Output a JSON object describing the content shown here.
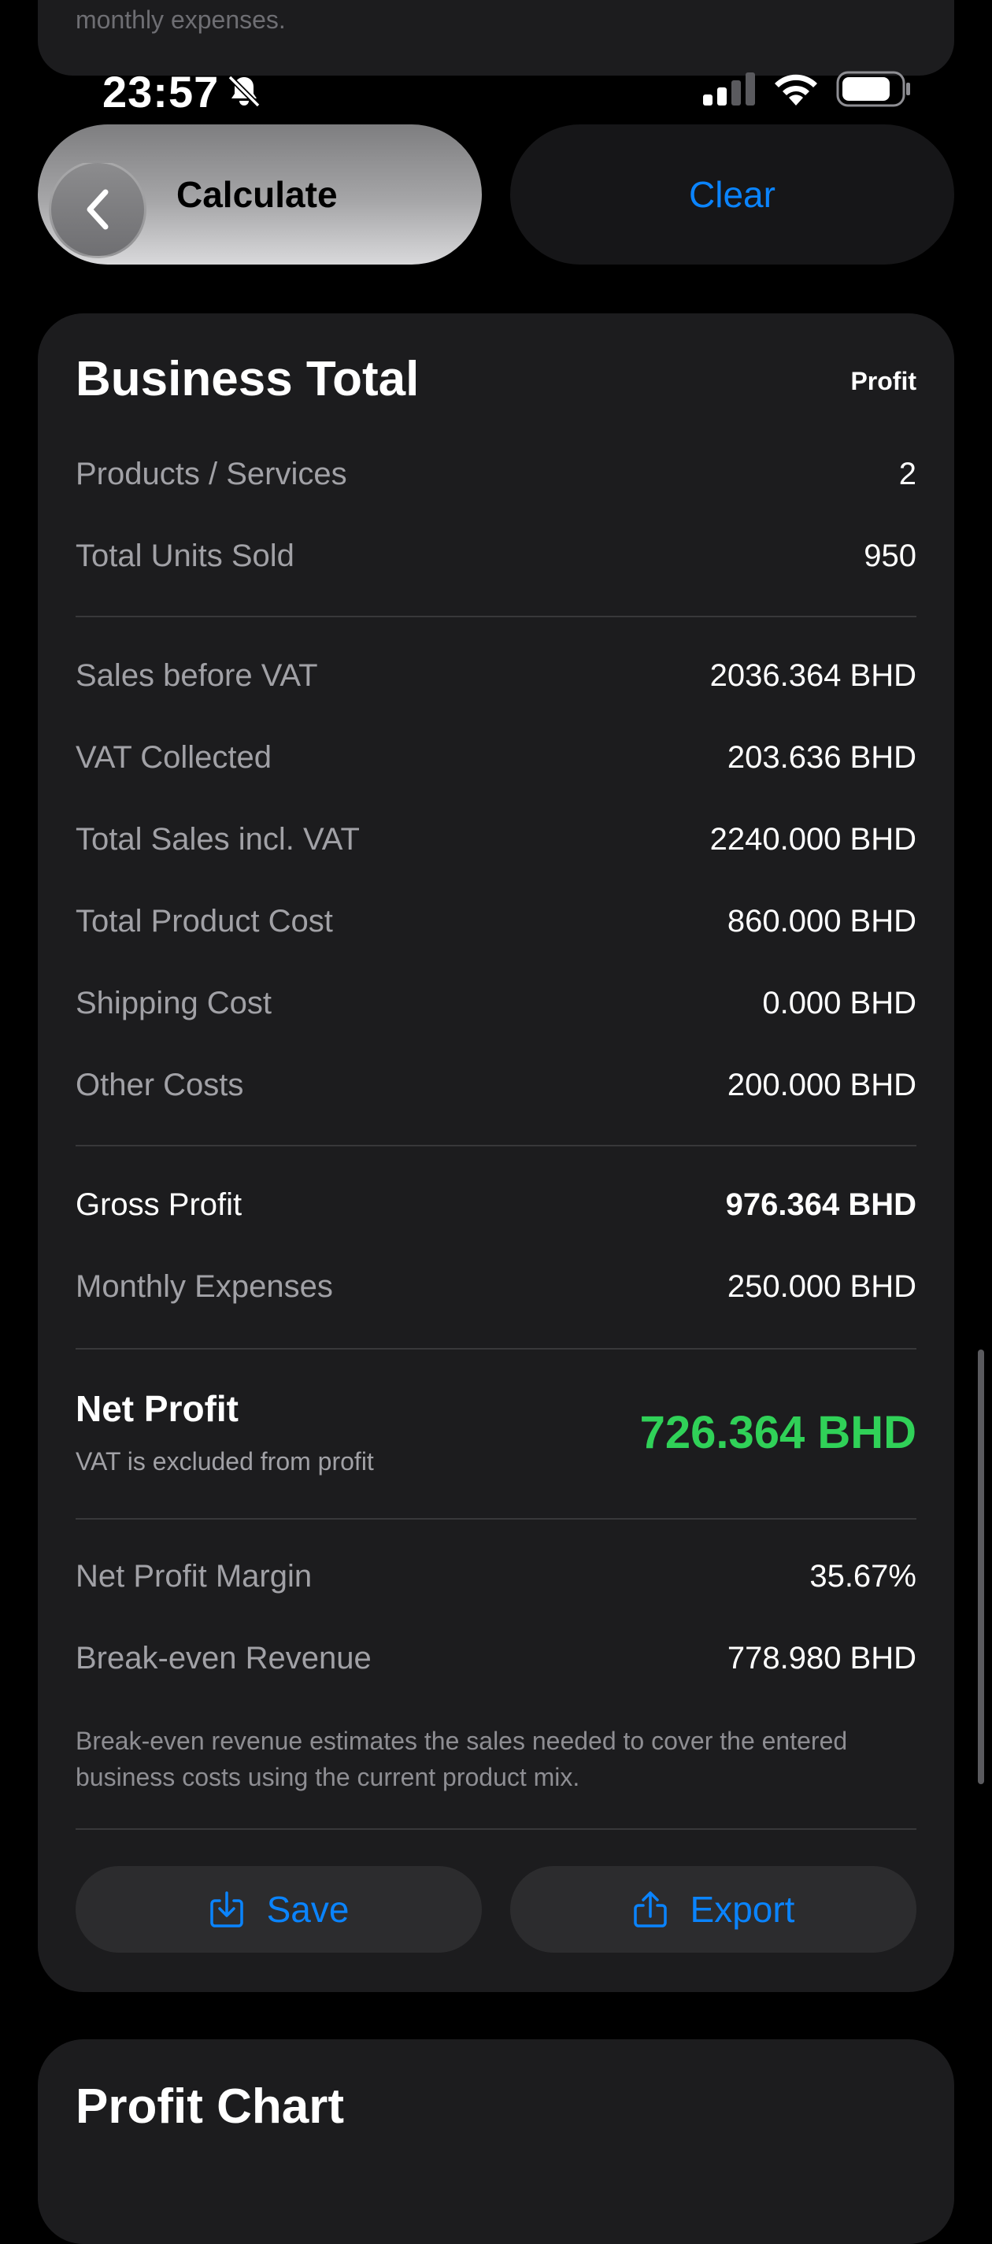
{
  "previous_card": {
    "text": "monthly expenses."
  },
  "status_bar": {
    "time": "23:57",
    "icons": [
      "bell-slash-icon",
      "cellular-signal-icon",
      "wifi-icon",
      "battery-icon"
    ]
  },
  "actions": {
    "calculate_label": "Calculate",
    "clear_label": "Clear"
  },
  "business_total": {
    "title": "Business Total",
    "badge": "Profit",
    "rows_top": [
      {
        "label": "Products / Services",
        "value": "2"
      },
      {
        "label": "Total Units Sold",
        "value": "950"
      }
    ],
    "rows_costs": [
      {
        "label": "Sales before VAT",
        "value": "2036.364 BHD"
      },
      {
        "label": "VAT Collected",
        "value": "203.636 BHD"
      },
      {
        "label": "Total Sales incl. VAT",
        "value": "2240.000 BHD"
      },
      {
        "label": "Total Product Cost",
        "value": "860.000 BHD"
      },
      {
        "label": "Shipping Cost",
        "value": "0.000 BHD"
      },
      {
        "label": "Other Costs",
        "value": "200.000 BHD"
      }
    ],
    "gross_profit": {
      "label": "Gross Profit",
      "value": "976.364 BHD"
    },
    "monthly_expenses": {
      "label": "Monthly Expenses",
      "value": "250.000 BHD"
    },
    "net_profit": {
      "label": "Net Profit",
      "subtitle": "VAT is excluded from profit",
      "value": "726.364 BHD"
    },
    "net_profit_margin": {
      "label": "Net Profit Margin",
      "value": "35.67%"
    },
    "break_even": {
      "label": "Break-even Revenue",
      "value": "778.980 BHD"
    },
    "note": "Break-even revenue estimates the sales needed to cover the entered business costs using the current product mix.",
    "save_label": "Save",
    "export_label": "Export"
  },
  "profit_chart": {
    "title": "Profit Chart"
  },
  "colors": {
    "background": "#000000",
    "card": "#1c1c1e",
    "accent_blue": "#0a84ff",
    "profit_green": "#30d158",
    "secondary_text": "#a1a1a6"
  }
}
